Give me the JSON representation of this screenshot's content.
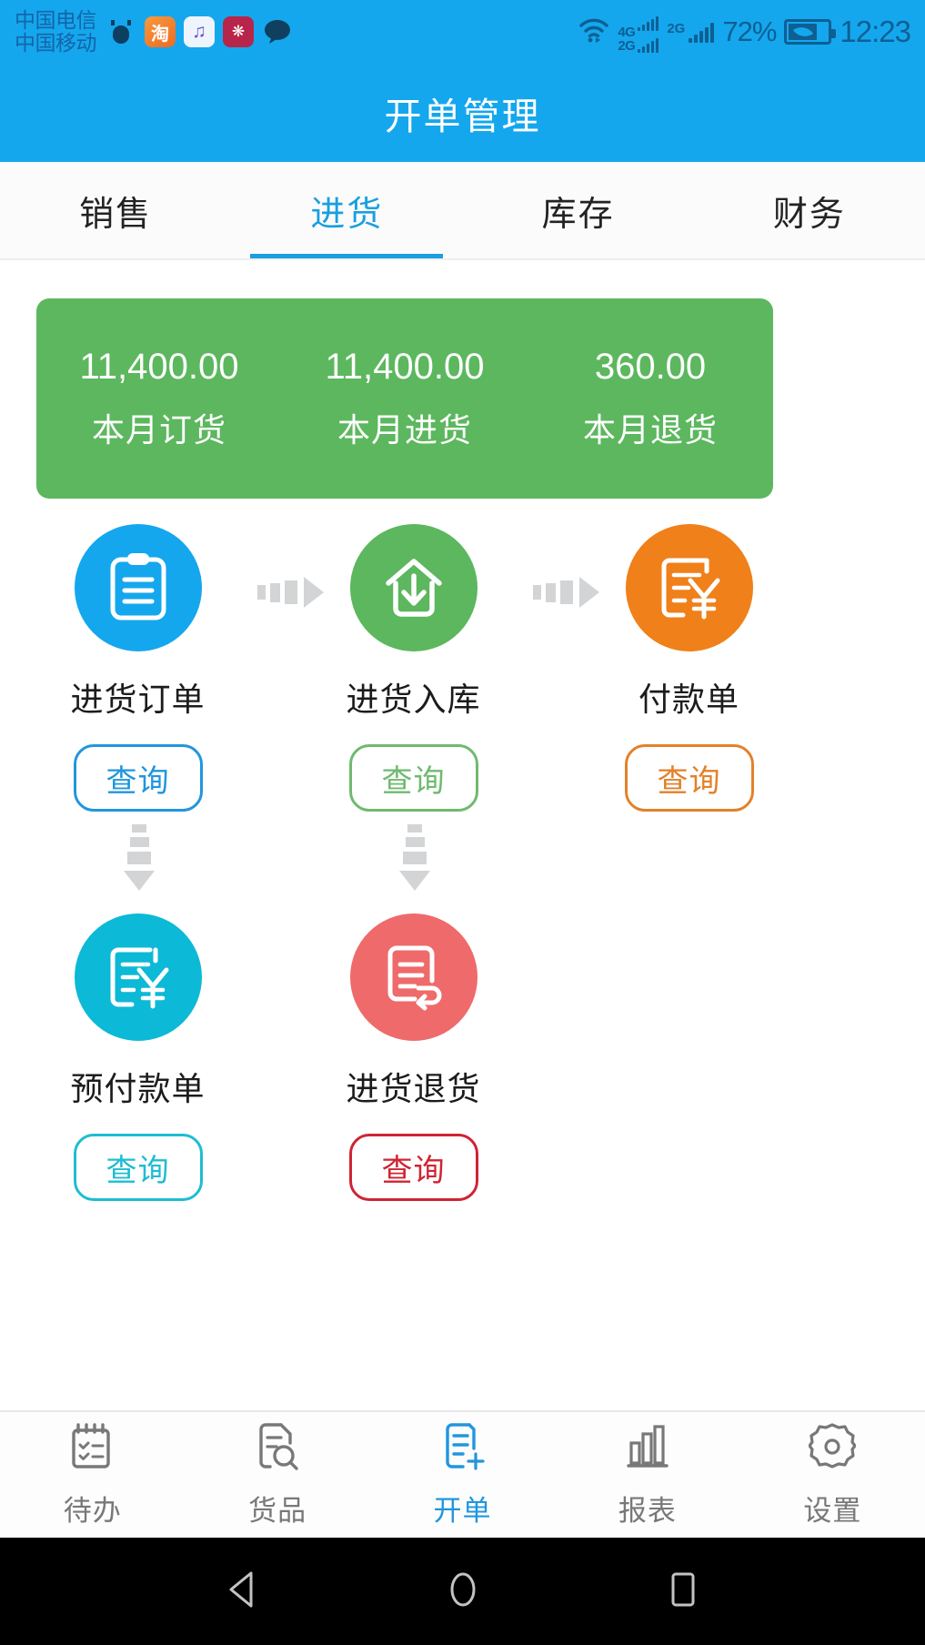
{
  "status_bar": {
    "carrier_1": "中国电信",
    "carrier_2": "中国移动",
    "notif_icons": [
      "ox-app-icon",
      "taobao-icon",
      "music-icon",
      "huawei-icon",
      "chat-bubble-icon"
    ],
    "taobao_glyph": "淘",
    "music_glyph": "♫",
    "huawei_glyph": "❋",
    "network_1_label_top": "4G",
    "network_1_label_bottom": "2G",
    "network_2_label": "2G",
    "battery_percent": "72%",
    "time": "12:23"
  },
  "header": {
    "title": "开单管理",
    "bg_color": "#14a7ee"
  },
  "tabs": {
    "items": [
      {
        "label": "销售",
        "active": false
      },
      {
        "label": "进货",
        "active": true
      },
      {
        "label": "库存",
        "active": false
      },
      {
        "label": "财务",
        "active": false
      }
    ],
    "active_color": "#1a9fe0"
  },
  "summary": {
    "bg_color": "#5cb75e",
    "cells": [
      {
        "value": "11,400.00",
        "label": "本月订货"
      },
      {
        "value": "11,400.00",
        "label": "本月进货"
      },
      {
        "value": "360.00",
        "label": "本月退货"
      }
    ]
  },
  "flow": {
    "row1": [
      {
        "label": "进货订单",
        "button": "查询",
        "icon": "clipboard-list-icon",
        "color": "#14a7ee"
      },
      {
        "label": "进货入库",
        "button": "查询",
        "icon": "warehouse-inbound-icon",
        "color": "#5cb75e"
      },
      {
        "label": "付款单",
        "button": "查询",
        "icon": "invoice-yuan-icon",
        "color": "#f08019"
      }
    ],
    "row2": [
      {
        "label": "预付款单",
        "button": "查询",
        "icon": "invoice-yuan-icon",
        "color": "#0cb9d6"
      },
      {
        "label": "进货退货",
        "button": "查询",
        "icon": "document-return-icon",
        "color": "#ef6a6a"
      }
    ]
  },
  "bottom_nav": {
    "items": [
      {
        "label": "待办",
        "icon": "calendar-checklist-icon",
        "active": false
      },
      {
        "label": "货品",
        "icon": "document-search-icon",
        "active": false
      },
      {
        "label": "开单",
        "icon": "document-plus-icon",
        "active": true
      },
      {
        "label": "报表",
        "icon": "bar-chart-icon",
        "active": false
      },
      {
        "label": "设置",
        "icon": "gear-icon",
        "active": false
      }
    ],
    "active_color": "#2196dd"
  },
  "android_nav": {
    "back": "back-triangle-icon",
    "home": "home-circle-icon",
    "recents": "recents-square-icon"
  }
}
